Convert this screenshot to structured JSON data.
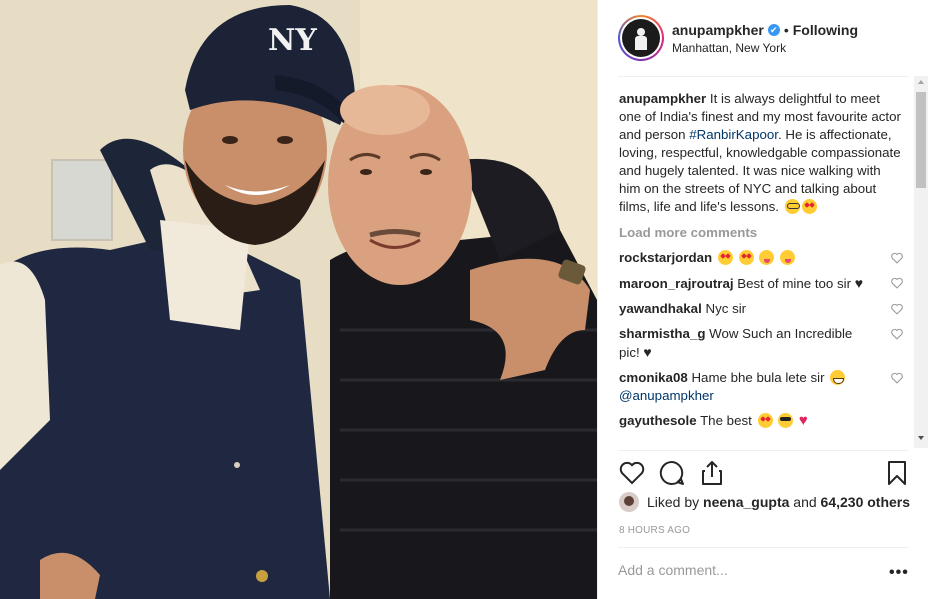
{
  "header": {
    "username": "anupampkher",
    "verified_mark": "✔",
    "separator": "•",
    "follow_label": "Following",
    "location": "Manhattan, New York"
  },
  "caption": {
    "username": "anupampkher",
    "text_before_tag": "It is always delightful to meet one of India's finest and my most favourite actor and person ",
    "hashtag": "#RanbirKapoor",
    "text_after_tag": ". He is affectionate, loving, respectful, knowledgable compassionate and hugely talented. It was nice walking with him on the streets of NYC and talking about films, life and life's lessons."
  },
  "load_more_label": "Load more comments",
  "comments": [
    {
      "user": "rockstarjordan",
      "text": ""
    },
    {
      "user": "maroon_rajroutraj",
      "text": "Best of mine too sir"
    },
    {
      "user": "yawandhakal",
      "text": "Nyc sir"
    },
    {
      "user": "sharmistha_g",
      "text": "Wow Such an Incredible pic!"
    },
    {
      "user": "cmonika08",
      "text": "Hame bhe bula lete sir",
      "mention": "@anupampkher"
    },
    {
      "user": "gayuthesole",
      "text": "The best"
    }
  ],
  "likes": {
    "prefix": "Liked by",
    "user": "neena_gupta",
    "and": "and",
    "count": "64,230 others"
  },
  "timestamp": "8 HOURS AGO",
  "add_comment_placeholder": "Add a comment...",
  "more_label": "•••",
  "icons": {
    "like": "heart-outline-icon",
    "comment": "comment-icon",
    "share": "share-icon",
    "save": "bookmark-icon"
  }
}
